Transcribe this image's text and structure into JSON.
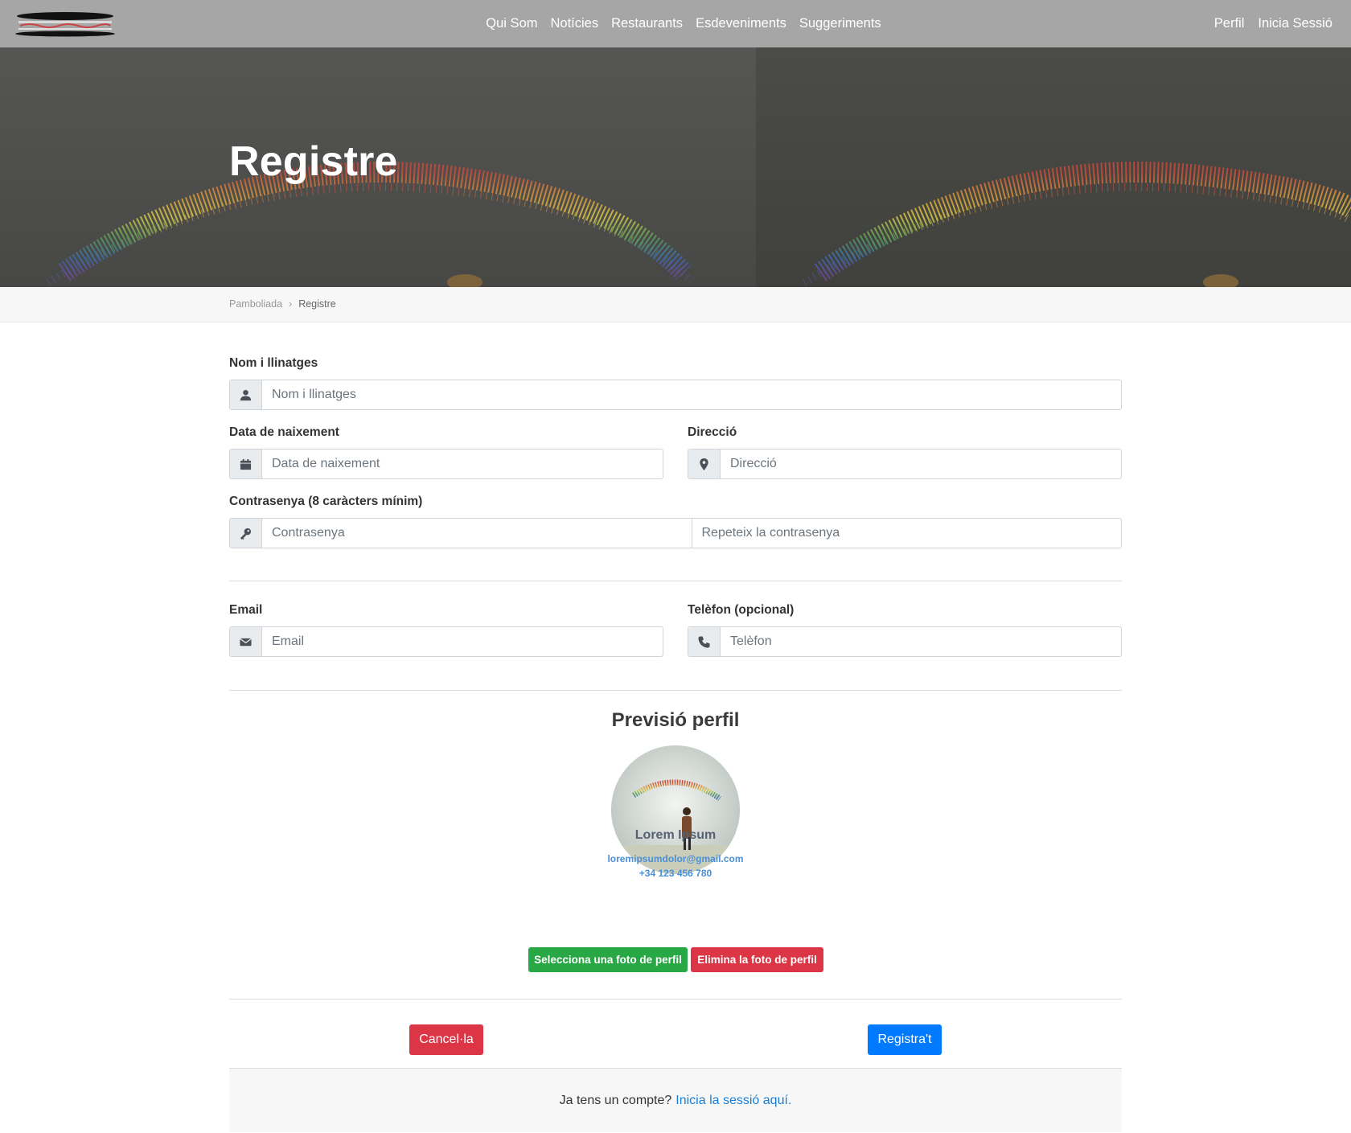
{
  "nav": {
    "logo": "logo",
    "links": [
      "Qui Som",
      "Notícies",
      "Restaurants",
      "Esdeveniments",
      "Suggeriments"
    ],
    "right": [
      "Perfil",
      "Inicia Sessió"
    ]
  },
  "hero": {
    "title": "Registre"
  },
  "breadcrumb": {
    "root": "Pamboliada",
    "separator": "›",
    "current": "Registre"
  },
  "form": {
    "name": {
      "label": "Nom i llinatges",
      "placeholder": "Nom i llinatges",
      "icon": "user-icon"
    },
    "birth": {
      "label": "Data de naixement",
      "placeholder": "Data de naixement",
      "icon": "calendar-icon"
    },
    "address": {
      "label": "Direcció",
      "placeholder": "Direcció",
      "icon": "map-marker-icon"
    },
    "password": {
      "label": "Contrasenya (8 caràcters mínim)",
      "placeholder": "Contrasenya",
      "repeat_placeholder": "Repeteix la contrasenya",
      "icon": "key-icon"
    },
    "email": {
      "label": "Email",
      "placeholder": "Email",
      "icon": "envelope-icon"
    },
    "phone": {
      "label": "Telèfon (opcional)",
      "placeholder": "Telèfon",
      "icon": "phone-icon"
    }
  },
  "preview": {
    "title": "Previsió perfil",
    "name": "Lorem Ipsum",
    "email": "loremipsumdolor@gmail.com",
    "phone": "+34 123 456 780",
    "select_photo": "Selecciona una foto de perfil",
    "delete_photo": "Elimina la foto de perfil"
  },
  "actions": {
    "cancel": "Cancel·la",
    "register": "Registra't"
  },
  "footer": {
    "text": "Ja tens un compte?",
    "link": "Inicia la sessió aquí."
  },
  "colors": {
    "navbar": "#a6a6a6",
    "green": "#28a745",
    "red": "#dc3545",
    "blue": "#007bff"
  }
}
